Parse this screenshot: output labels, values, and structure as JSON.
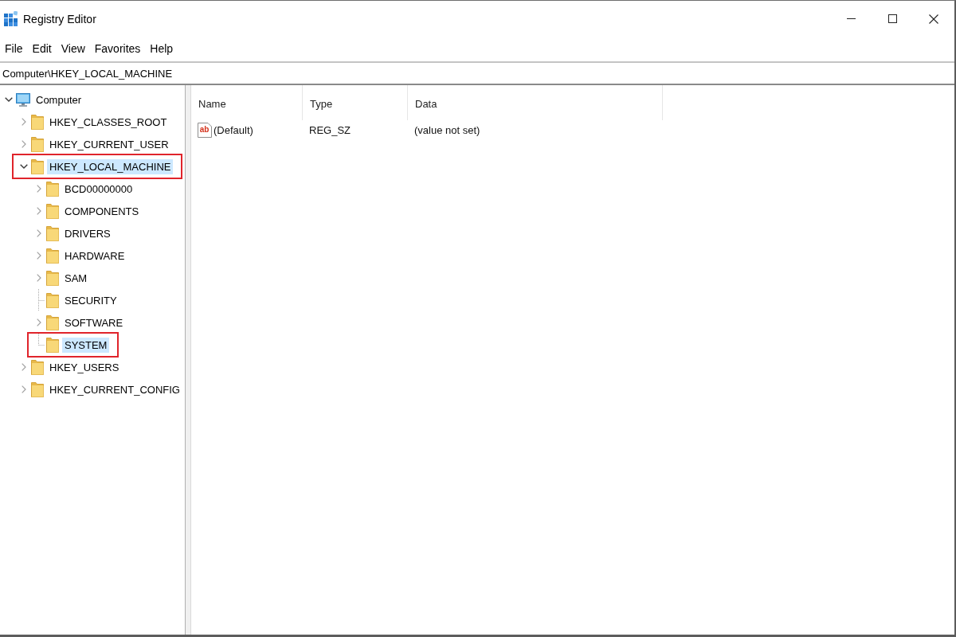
{
  "window": {
    "title": "Registry Editor"
  },
  "menu": [
    "File",
    "Edit",
    "View",
    "Favorites",
    "Help"
  ],
  "address_bar": {
    "value": "Computer\\HKEY_LOCAL_MACHINE"
  },
  "tree": {
    "items": [
      {
        "label": "Computer",
        "kind": "computer",
        "expandable": true,
        "expanded": true,
        "selected": false,
        "outlined": false,
        "children": [
          {
            "label": "HKEY_CLASSES_ROOT",
            "kind": "folder",
            "expandable": true,
            "expanded": false,
            "selected": false,
            "outlined": false
          },
          {
            "label": "HKEY_CURRENT_USER",
            "kind": "folder",
            "expandable": true,
            "expanded": false,
            "selected": false,
            "outlined": false
          },
          {
            "label": "HKEY_LOCAL_MACHINE",
            "kind": "folder",
            "expandable": true,
            "expanded": true,
            "selected": true,
            "outlined": true,
            "children": [
              {
                "label": "BCD00000000",
                "kind": "folder",
                "expandable": true,
                "expanded": false,
                "selected": false,
                "outlined": false
              },
              {
                "label": "COMPONENTS",
                "kind": "folder",
                "expandable": true,
                "expanded": false,
                "selected": false,
                "outlined": false
              },
              {
                "label": "DRIVERS",
                "kind": "folder",
                "expandable": true,
                "expanded": false,
                "selected": false,
                "outlined": false
              },
              {
                "label": "HARDWARE",
                "kind": "folder",
                "expandable": true,
                "expanded": false,
                "selected": false,
                "outlined": false
              },
              {
                "label": "SAM",
                "kind": "folder",
                "expandable": true,
                "expanded": false,
                "selected": false,
                "outlined": false
              },
              {
                "label": "SECURITY",
                "kind": "folder",
                "expandable": false,
                "selected": false,
                "outlined": false
              },
              {
                "label": "SOFTWARE",
                "kind": "folder",
                "expandable": true,
                "expanded": false,
                "selected": false,
                "outlined": false
              },
              {
                "label": "SYSTEM",
                "kind": "folder",
                "expandable": false,
                "selected": true,
                "outlined": true
              }
            ]
          },
          {
            "label": "HKEY_USERS",
            "kind": "folder",
            "expandable": true,
            "expanded": false,
            "selected": false,
            "outlined": false
          },
          {
            "label": "HKEY_CURRENT_CONFIG",
            "kind": "folder",
            "expandable": true,
            "expanded": false,
            "selected": false,
            "outlined": false
          }
        ]
      }
    ]
  },
  "values_list": {
    "columns": [
      "Name",
      "Type",
      "Data"
    ],
    "rows": [
      {
        "icon_text": "ab",
        "name": "(Default)",
        "type": "REG_SZ",
        "data": "(value not set)"
      }
    ]
  }
}
